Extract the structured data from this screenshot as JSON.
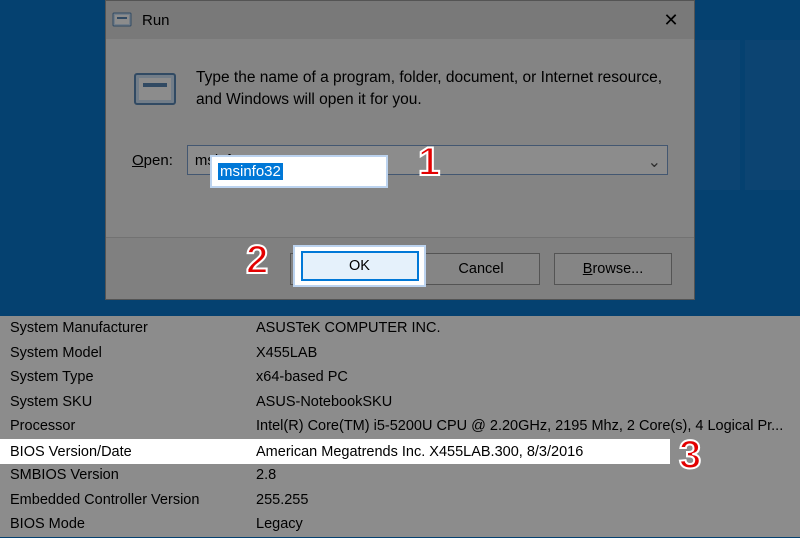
{
  "run_dialog": {
    "title": "Run",
    "prompt": "Type the name of a program, folder, document, or Internet resource, and Windows will open it for you.",
    "open_label_prefix": "O",
    "open_label_rest": "pen:",
    "input_value": "msinfo32",
    "dropdown_glyph": "⌄",
    "buttons": {
      "ok": "OK",
      "cancel": "Cancel",
      "browse_prefix": "B",
      "browse_rest": "rowse..."
    },
    "close_glyph": "✕"
  },
  "sysinfo_rows": [
    {
      "k": "System Manufacturer",
      "v": "ASUSTeK COMPUTER INC."
    },
    {
      "k": "System Model",
      "v": "X455LAB"
    },
    {
      "k": "System Type",
      "v": "x64-based PC"
    },
    {
      "k": "System SKU",
      "v": "ASUS-NotebookSKU"
    },
    {
      "k": "Processor",
      "v": "Intel(R) Core(TM) i5-5200U CPU @ 2.20GHz, 2195 Mhz, 2 Core(s), 4 Logical Pr..."
    },
    {
      "k": "BIOS Version/Date",
      "v": "American Megatrends Inc. X455LAB.300, 8/3/2016"
    },
    {
      "k": "SMBIOS Version",
      "v": "2.8"
    },
    {
      "k": "Embedded Controller Version",
      "v": "255.255"
    },
    {
      "k": "BIOS Mode",
      "v": "Legacy"
    }
  ],
  "callouts": {
    "one": "1",
    "two": "2",
    "three": "3"
  },
  "highlight_row_index": 5
}
